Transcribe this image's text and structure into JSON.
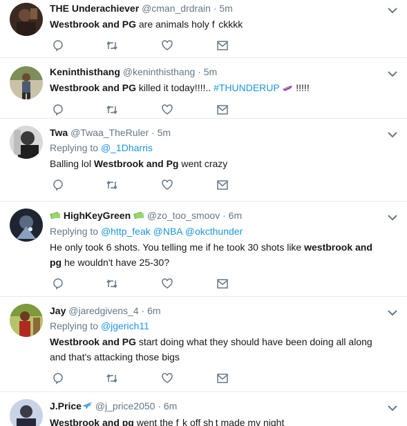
{
  "tweets": [
    {
      "name": "THE Underachiever",
      "handle": "@cman_drdrain",
      "time": "5m",
      "text_bold": "Westbrook and PG",
      "text_rest": " are animals holy f  ckkkk"
    },
    {
      "name": "Keninthisthang",
      "handle": "@keninthisthang",
      "time": "5m",
      "text_bold": "Westbrook and PG",
      "text_rest": " killed it today!!!!.. ",
      "hashtag": "#THUNDERUP",
      "text_after": " !!!!!"
    },
    {
      "name": "Twa",
      "handle": "@Twaa_TheRuler",
      "time": "5m",
      "replying_label": "Replying to ",
      "replying_to": "@_1Dharris",
      "text_pre": "Balling lol ",
      "text_bold": "Westbrook and Pg",
      "text_rest": " went crazy"
    },
    {
      "name": "HighKeyGreen",
      "handle": "@zo_too_smoov",
      "time": "6m",
      "replying_label": "Replying to ",
      "replying_to": "@http_feak @NBA @okcthunder",
      "text_pre": "He only took 6 shots. You telling me if he took 30 shots like ",
      "text_bold": "westbrook and pg",
      "text_rest": " he wouldn't have 25-30?"
    },
    {
      "name": "Jay",
      "handle": "@jaredgivens_4",
      "time": "6m",
      "replying_label": "Replying to ",
      "replying_to": "@jgerich11",
      "text_bold": "Westbrook and PG",
      "text_rest": " start doing what they should have been doing all along and that's attacking those bigs"
    },
    {
      "name": "J.Price",
      "handle": "@j_price2050",
      "time": "6m",
      "text_bold": "Westbrook and pg",
      "text_rest": " went the f  k off sh t made my night"
    }
  ],
  "separator": "·",
  "colors": {
    "muted": "#657786",
    "link": "#1b95e0",
    "border": "#e6ecf0"
  },
  "icons": [
    "reply-icon",
    "retweet-icon",
    "like-icon",
    "message-icon",
    "chevron-down-icon"
  ]
}
